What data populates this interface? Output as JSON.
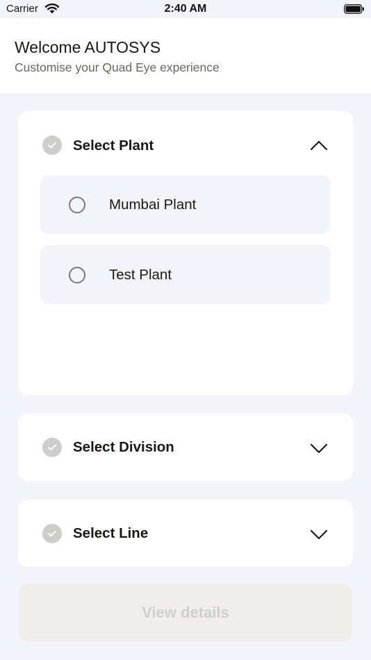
{
  "status_bar": {
    "carrier": "Carrier",
    "time": "2:40 AM"
  },
  "header": {
    "welcome": "Welcome AUTOSYS",
    "subtitle": "Customise your Quad Eye experience"
  },
  "sections": {
    "plant": {
      "title": "Select Plant",
      "expanded": true,
      "options": [
        {
          "label": "Mumbai Plant",
          "selected": false
        },
        {
          "label": "Test Plant",
          "selected": false
        }
      ]
    },
    "division": {
      "title": "Select Division",
      "expanded": false
    },
    "line": {
      "title": "Select Line",
      "expanded": false
    }
  },
  "actions": {
    "view_details": "View details",
    "view_details_enabled": false
  },
  "colors": {
    "background": "#f3f4f9",
    "card": "#ffffff",
    "check_inactive": "#cfcdca",
    "text_primary": "#1b1712",
    "button_disabled_bg": "#efeeec",
    "button_disabled_text": "#cfcecb"
  }
}
